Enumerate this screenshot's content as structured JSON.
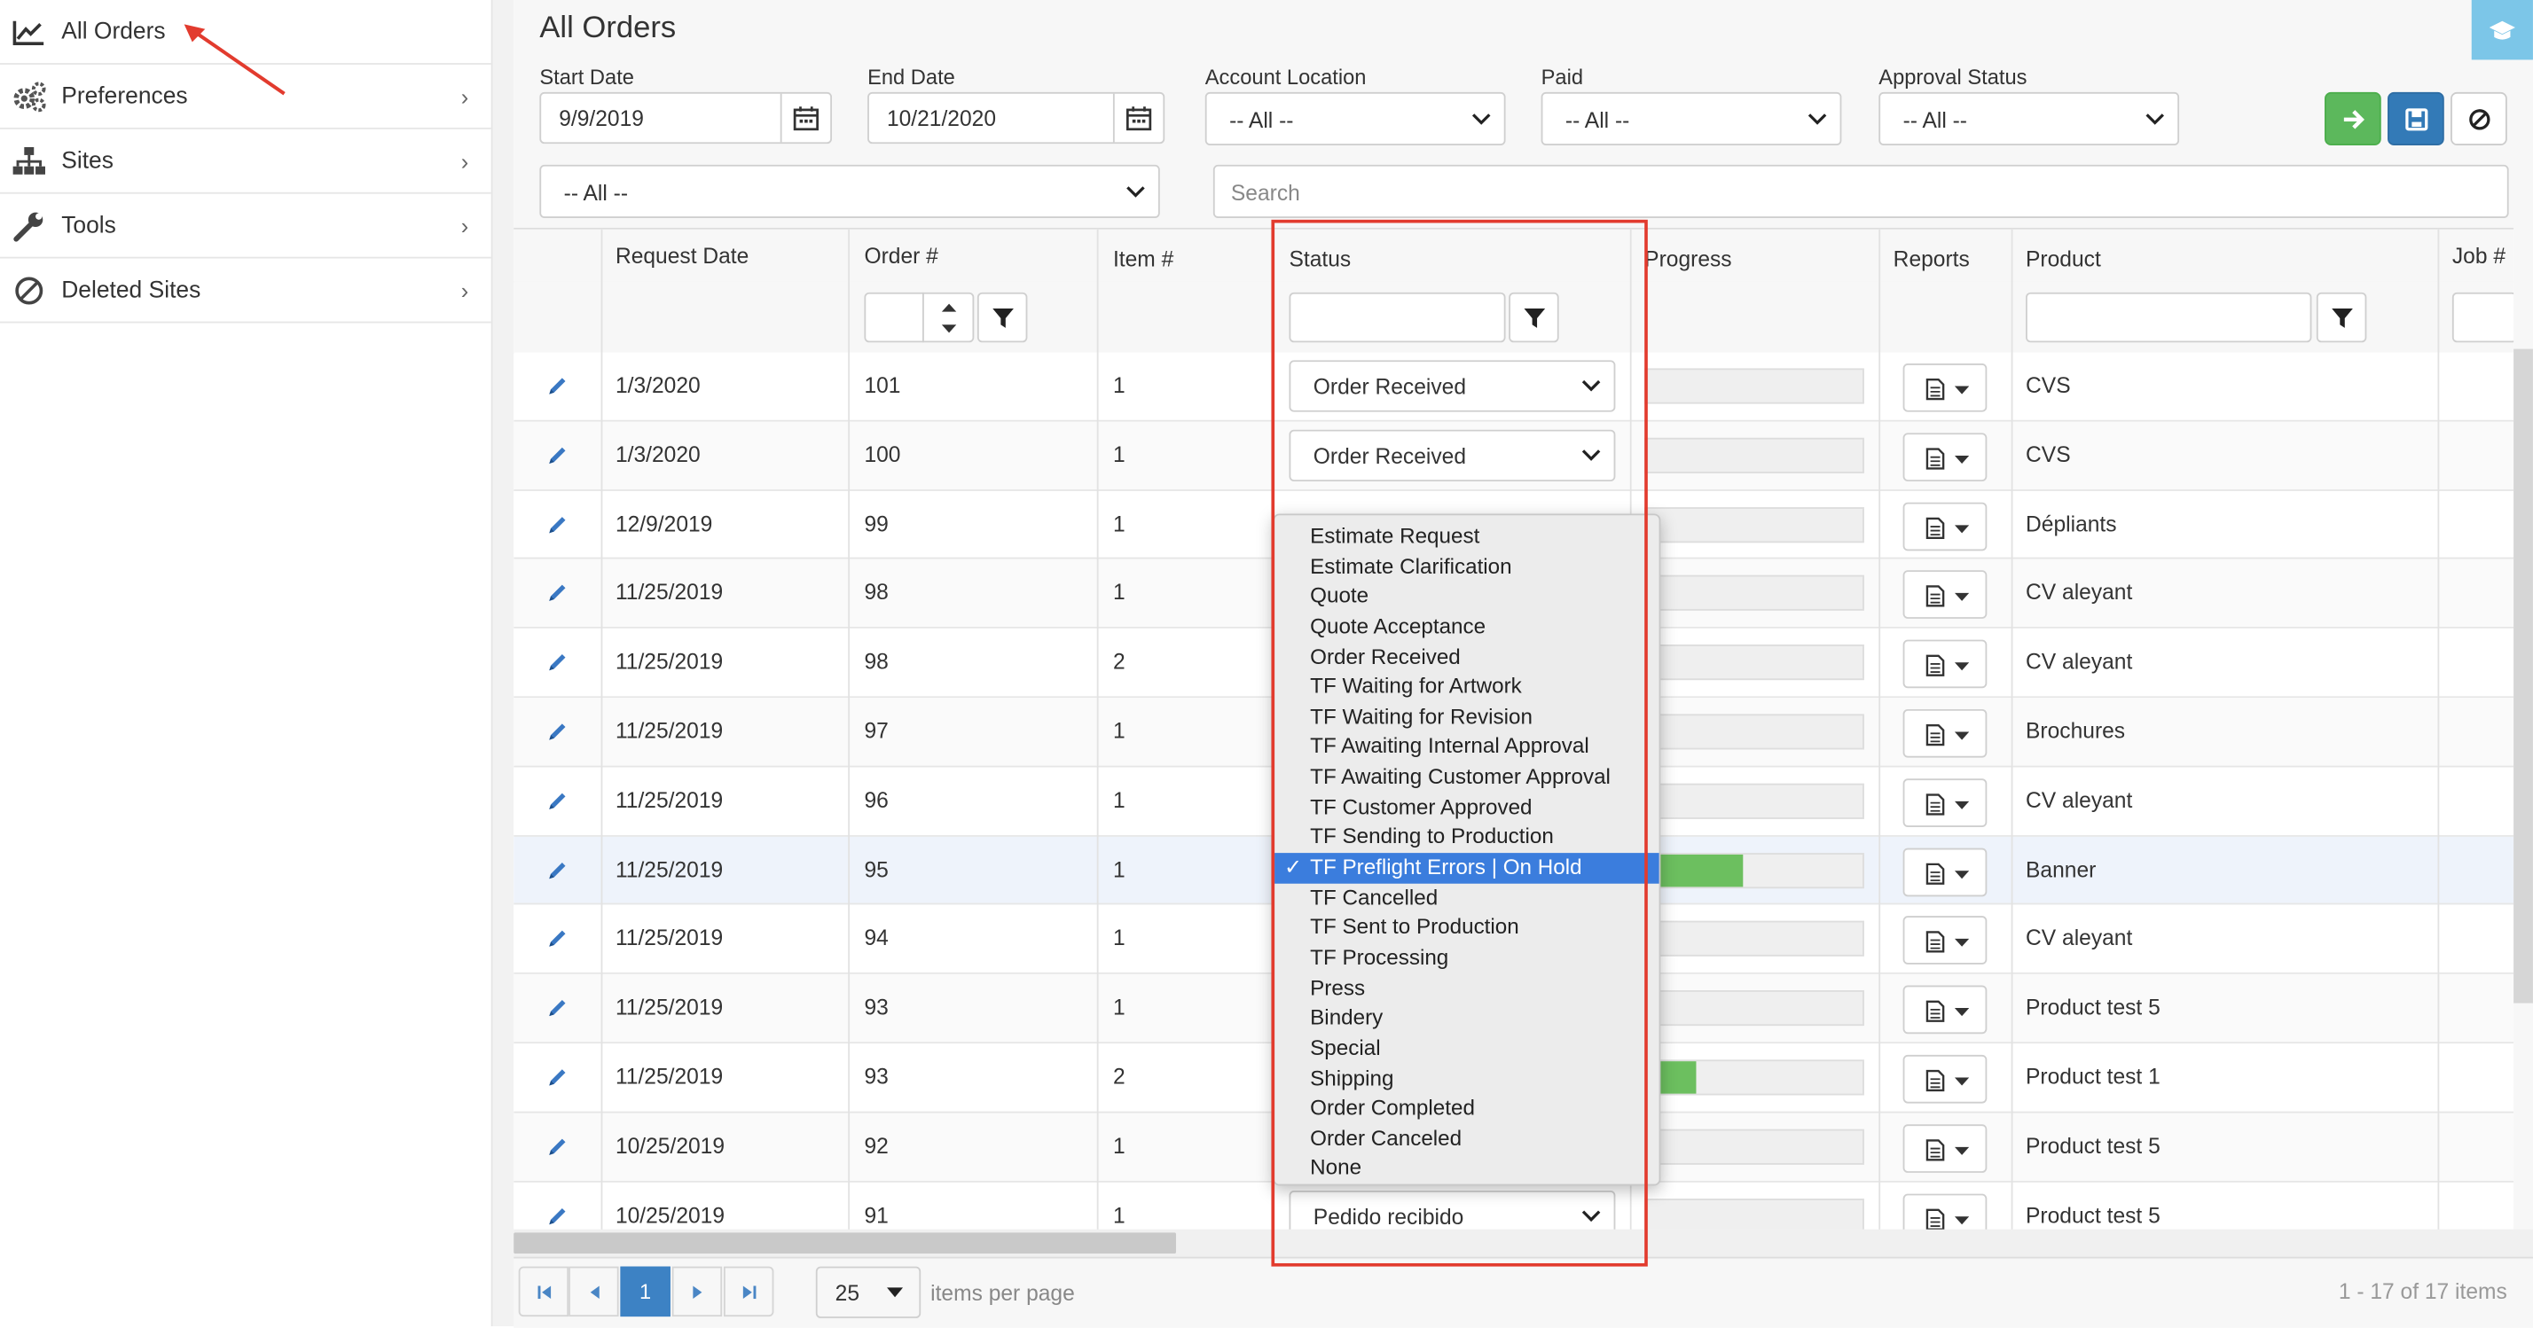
{
  "sidebar": {
    "items": [
      {
        "label": "All Orders",
        "icon": "line-chart-icon",
        "has_chevron": false,
        "active": true
      },
      {
        "label": "Preferences",
        "icon": "gears-icon",
        "has_chevron": true
      },
      {
        "label": "Sites",
        "icon": "sitemap-icon",
        "has_chevron": true
      },
      {
        "label": "Tools",
        "icon": "wrench-icon",
        "has_chevron": true
      },
      {
        "label": "Deleted Sites",
        "icon": "ban-icon",
        "has_chevron": true
      }
    ],
    "chevron": "›"
  },
  "page": {
    "title": "All Orders"
  },
  "filters": {
    "start_date_label": "Start Date",
    "start_date": "9/9/2019",
    "end_date_label": "End Date",
    "end_date": "10/21/2020",
    "account_location_label": "Account Location",
    "account_location": "-- All --",
    "paid_label": "Paid",
    "paid": "-- All --",
    "approval_status_label": "Approval Status",
    "approval_status": "-- All --",
    "second_select": "-- All --",
    "search_placeholder": "Search"
  },
  "toolbar": {
    "colors": {
      "go": "#5cb85c",
      "save": "#337ab7",
      "corner": "#7cc6e8"
    }
  },
  "grid": {
    "headers": [
      "Request Date",
      "Order #",
      "Item #",
      "Status",
      "Progress",
      "Reports",
      "Product",
      "Job #"
    ],
    "rows": [
      {
        "date": "1/3/2020",
        "order": "101",
        "item": "1",
        "status": "Order Received",
        "progress": 0,
        "product": "CVS"
      },
      {
        "date": "1/3/2020",
        "order": "100",
        "item": "1",
        "status": "Order Received",
        "progress": 0,
        "product": "CVS"
      },
      {
        "date": "12/9/2019",
        "order": "99",
        "item": "1",
        "status": "",
        "progress": 0,
        "product": "Dépliants"
      },
      {
        "date": "11/25/2019",
        "order": "98",
        "item": "1",
        "status": "",
        "progress": 0,
        "product": "CV aleyant"
      },
      {
        "date": "11/25/2019",
        "order": "98",
        "item": "2",
        "status": "",
        "progress": 0,
        "product": "CV aleyant"
      },
      {
        "date": "11/25/2019",
        "order": "97",
        "item": "1",
        "status": "",
        "progress": 0,
        "product": "Brochures"
      },
      {
        "date": "11/25/2019",
        "order": "96",
        "item": "1",
        "status": "",
        "progress": 0,
        "product": "CV aleyant"
      },
      {
        "date": "11/25/2019",
        "order": "95",
        "item": "1",
        "status": "",
        "progress": 0.45,
        "product": "Banner",
        "selected": true
      },
      {
        "date": "11/25/2019",
        "order": "94",
        "item": "1",
        "status": "",
        "progress": 0,
        "product": "CV aleyant"
      },
      {
        "date": "11/25/2019",
        "order": "93",
        "item": "1",
        "status": "",
        "progress": 0,
        "product": "Product test 5"
      },
      {
        "date": "11/25/2019",
        "order": "93",
        "item": "2",
        "status": "",
        "progress": 0.23,
        "product": "Product test 1"
      },
      {
        "date": "10/25/2019",
        "order": "92",
        "item": "1",
        "status": "",
        "progress": 0,
        "product": "Product test 5"
      },
      {
        "date": "10/25/2019",
        "order": "91",
        "item": "1",
        "status": "Pedido recibido",
        "progress": 0,
        "product": "Product test 5"
      }
    ]
  },
  "status_dropdown": {
    "options": [
      "Estimate Request",
      "Estimate Clarification",
      "Quote",
      "Quote Acceptance",
      "Order Received",
      "TF Waiting for Artwork",
      "TF Waiting for Revision",
      "TF Awaiting Internal Approval",
      "TF Awaiting Customer Approval",
      "TF Customer Approved",
      "TF Sending to Production",
      "TF Preflight Errors | On Hold",
      "TF Cancelled",
      "TF Sent to Production",
      "TF Processing",
      "Press",
      "Bindery",
      "Special",
      "Shipping",
      "Order Completed",
      "Order Canceled",
      "None"
    ],
    "selected_index": 11,
    "check_mark": "✓"
  },
  "pager": {
    "current_page": "1",
    "page_size": "25",
    "items_per_page_label": "items per page",
    "summary": "1 - 17 of 17 items"
  },
  "annotation": {
    "highlight_color": "#e23b2e"
  }
}
